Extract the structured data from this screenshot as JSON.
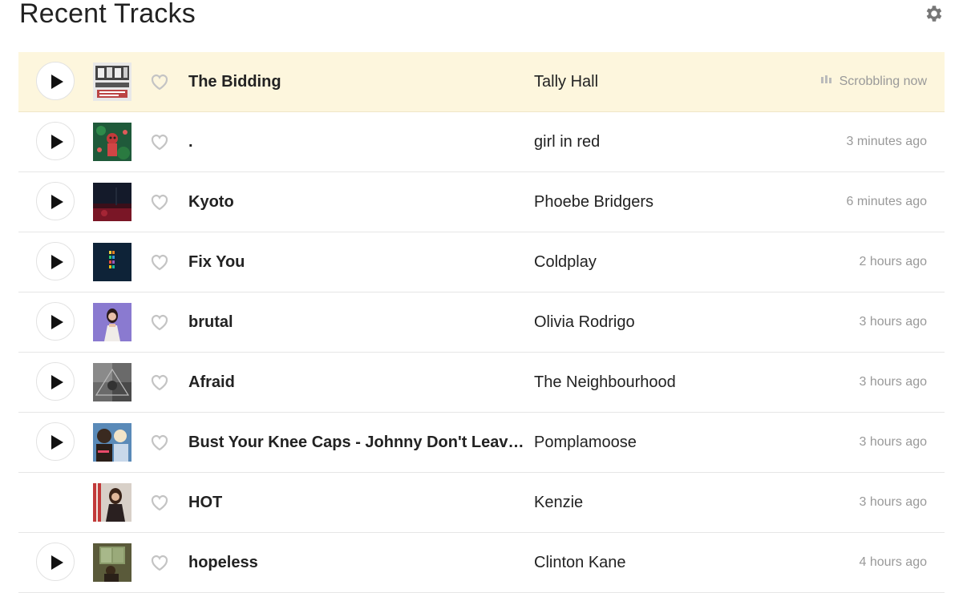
{
  "header": {
    "title": "Recent Tracks",
    "settings_icon": "gear-icon"
  },
  "tracks": [
    {
      "title": "The Bidding",
      "artist": "Tally Hall",
      "time": "Scrobbling now",
      "now_playing": true,
      "playable": true
    },
    {
      "title": ".",
      "artist": "girl in red",
      "time": "3 minutes ago",
      "playable": true
    },
    {
      "title": "Kyoto",
      "artist": "Phoebe Bridgers",
      "time": "6 minutes ago",
      "playable": true
    },
    {
      "title": "Fix You",
      "artist": "Coldplay",
      "time": "2 hours ago",
      "playable": true
    },
    {
      "title": "brutal",
      "artist": "Olivia Rodrigo",
      "time": "3 hours ago",
      "playable": true
    },
    {
      "title": "Afraid",
      "artist": "The Neighbourhood",
      "time": "3 hours ago",
      "playable": true
    },
    {
      "title": "Bust Your Knee Caps - Johnny Don't Leave...",
      "artist": "Pomplamoose",
      "time": "3 hours ago",
      "playable": true
    },
    {
      "title": "HOT",
      "artist": "Kenzie",
      "time": "3 hours ago",
      "playable": false
    },
    {
      "title": "hopeless",
      "artist": "Clinton Kane",
      "time": "4 hours ago",
      "playable": true
    }
  ],
  "colors": {
    "now_playing_bg": "#fdf6dd",
    "muted_text": "#999999",
    "divider": "#e6e6e6"
  }
}
